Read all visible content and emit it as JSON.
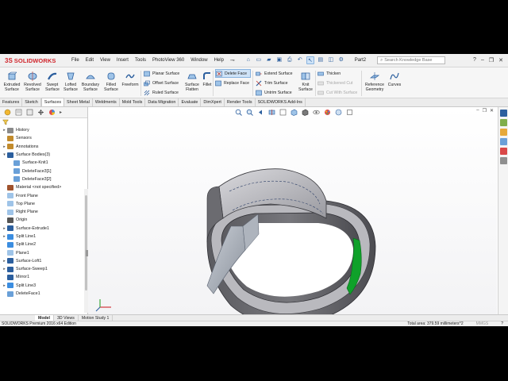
{
  "app": {
    "brand": "SOLIDWORKS",
    "document": "Part2",
    "search_placeholder": "Search Knowledge Base"
  },
  "menu": [
    "File",
    "Edit",
    "View",
    "Insert",
    "Tools",
    "PhotoView 360",
    "Window",
    "Help"
  ],
  "ribbon": {
    "large_buttons": [
      {
        "label": "Extruded\nSurface",
        "icon": "extruded-surface-icon"
      },
      {
        "label": "Revolved\nSurface",
        "icon": "revolved-surface-icon"
      },
      {
        "label": "Swept\nSurface",
        "icon": "swept-surface-icon"
      },
      {
        "label": "Lofted\nSurface",
        "icon": "lofted-surface-icon"
      },
      {
        "label": "Boundary\nSurface",
        "icon": "boundary-surface-icon"
      },
      {
        "label": "Filled\nSurface",
        "icon": "filled-surface-icon"
      },
      {
        "label": "Freeform",
        "icon": "freeform-icon"
      }
    ],
    "group2": [
      "Planar Surface",
      "Offset Surface",
      "Ruled Surface"
    ],
    "surface_flatten": "Surface\nFlatten",
    "fillet": "Fillet",
    "group3": [
      "Delete Face",
      "Replace Face"
    ],
    "group4": [
      "Extend Surface",
      "Trim Surface",
      "Untrim Surface"
    ],
    "knit": "Knit\nSurface",
    "group5": [
      "Thicken",
      "Thickened Cut",
      "Cut With Surface"
    ],
    "reference_geometry": "Reference\nGeometry",
    "curves": "Curves"
  },
  "tabs": [
    "Features",
    "Sketch",
    "Surfaces",
    "Sheet Metal",
    "Weldments",
    "Mold Tools",
    "Data Migration",
    "Evaluate",
    "DimXpert",
    "Render Tools",
    "SOLIDWORKS Add-Ins"
  ],
  "active_tab": "Surfaces",
  "tree": [
    {
      "label": "History",
      "icon": "history-icon",
      "indent": 0,
      "expander": "▸"
    },
    {
      "label": "Sensors",
      "icon": "sensors-icon",
      "indent": 0,
      "expander": ""
    },
    {
      "label": "Annotations",
      "icon": "annotations-icon",
      "indent": 0,
      "expander": "▸"
    },
    {
      "label": "Surface Bodies(3)",
      "icon": "surface-bodies-icon",
      "indent": 0,
      "expander": "▾"
    },
    {
      "label": "Surface-Knit1",
      "icon": "surface-body-icon",
      "indent": 1,
      "expander": ""
    },
    {
      "label": "DeleteFace3[1]",
      "icon": "surface-body-icon",
      "indent": 1,
      "expander": ""
    },
    {
      "label": "DeleteFace3[2]",
      "icon": "surface-body-icon",
      "indent": 1,
      "expander": ""
    },
    {
      "label": "Material <not specified>",
      "icon": "material-icon",
      "indent": 0,
      "expander": ""
    },
    {
      "label": "Front Plane",
      "icon": "plane-icon",
      "indent": 0,
      "expander": ""
    },
    {
      "label": "Top Plane",
      "icon": "plane-icon",
      "indent": 0,
      "expander": ""
    },
    {
      "label": "Right Plane",
      "icon": "plane-icon",
      "indent": 0,
      "expander": ""
    },
    {
      "label": "Origin",
      "icon": "origin-icon",
      "indent": 0,
      "expander": ""
    },
    {
      "label": "Surface-Extrude1",
      "icon": "surface-feature-icon",
      "indent": 0,
      "expander": "▸"
    },
    {
      "label": "Split Line1",
      "icon": "split-line-icon",
      "indent": 0,
      "expander": "▸"
    },
    {
      "label": "Split Line2",
      "icon": "split-line-icon",
      "indent": 0,
      "expander": ""
    },
    {
      "label": "Plane1",
      "icon": "plane-icon",
      "indent": 0,
      "expander": ""
    },
    {
      "label": "Surface-Loft1",
      "icon": "surface-feature-icon",
      "indent": 0,
      "expander": "▸"
    },
    {
      "label": "Surface-Sweep1",
      "icon": "surface-feature-icon",
      "indent": 0,
      "expander": "▸"
    },
    {
      "label": "Mirror1",
      "icon": "mirror-icon",
      "indent": 0,
      "expander": ""
    },
    {
      "label": "Split Line3",
      "icon": "split-line-icon",
      "indent": 0,
      "expander": "▸"
    },
    {
      "label": "DeleteFace1",
      "icon": "delete-face-icon",
      "indent": 0,
      "expander": ""
    }
  ],
  "bottom_tabs": [
    "Model",
    "3D Views",
    "Motion Study 1"
  ],
  "active_bottom_tab": "Model",
  "status": {
    "edition": "SOLIDWORKS Premium 2016 x64 Edition",
    "total_area": "Total area: 379.59 millimeters^2",
    "units": "MMGS"
  },
  "colors": {
    "brand_red": "#d0252c",
    "highlight": "#cfe3f7",
    "model_gray": "#6f6f73",
    "selected_face_green": "#0fa12a"
  }
}
